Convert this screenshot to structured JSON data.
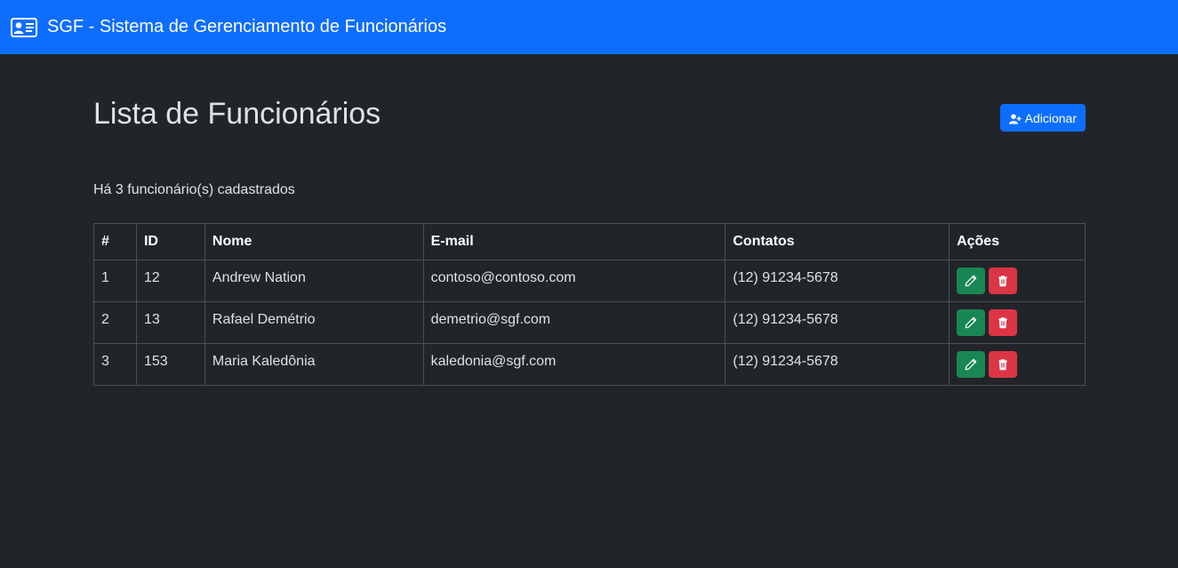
{
  "navbar": {
    "title": "SGF - Sistema de Gerenciamento de Funcionários",
    "icon": "id-card-icon"
  },
  "main": {
    "title": "Lista de Funcionários",
    "add_button_label": "Adicionar",
    "count_text": "Há 3 funcionário(s) cadastrados"
  },
  "table": {
    "headers": [
      "#",
      "ID",
      "Nome",
      "E-mail",
      "Contatos",
      "Ações"
    ],
    "rows": [
      {
        "num": "1",
        "id": "12",
        "name": "Andrew Nation",
        "email": "contoso@contoso.com",
        "contact": "(12) 91234-5678"
      },
      {
        "num": "2",
        "id": "13",
        "name": "Rafael Demétrio",
        "email": "demetrio@sgf.com",
        "contact": "(12) 91234-5678"
      },
      {
        "num": "3",
        "id": "153",
        "name": "Maria Kaledônia",
        "email": "kaledonia@sgf.com",
        "contact": "(12) 91234-5678"
      }
    ]
  },
  "colors": {
    "primary": "#0d6efd",
    "background": "#212529",
    "success": "#198754",
    "danger": "#dc3545"
  }
}
